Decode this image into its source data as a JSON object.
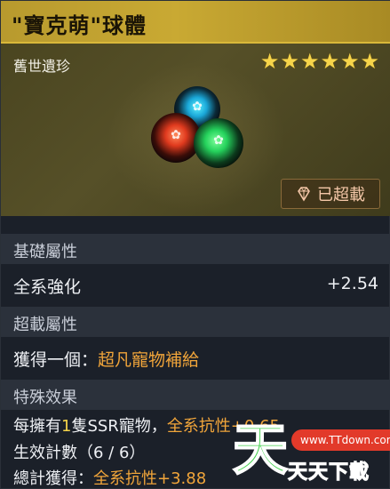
{
  "header": {
    "title": "\"寶克萌\"球體"
  },
  "hero": {
    "rarity": "舊世遺珍",
    "stars": "★★★★★★",
    "star_count": 6,
    "overload_label": "已超載"
  },
  "sections": {
    "base": {
      "title": "基礎屬性",
      "stat_name": "全系強化",
      "stat_value": "+2.54"
    },
    "overload": {
      "title": "超載屬性",
      "prefix": "獲得一個：",
      "reward": "超凡寵物補給"
    },
    "special": {
      "title": "特殊效果",
      "line1_a": "每擁有",
      "line1_num": "1",
      "line1_b": "隻SSR寵物，",
      "line1_c": "全系抗性+0.65",
      "line2": "生效計數（6 / 6）",
      "line3_a": "總計獲得：",
      "line3_b": "全系抗性+3.88"
    }
  },
  "watermark": {
    "big": "天",
    "pill": "www.TTdown.com",
    "small": "天天下載"
  },
  "colors": {
    "gold": "#c9a933",
    "accent_orange": "#f1a53a",
    "star": "#f6d44a",
    "panel": "#1b2029"
  }
}
